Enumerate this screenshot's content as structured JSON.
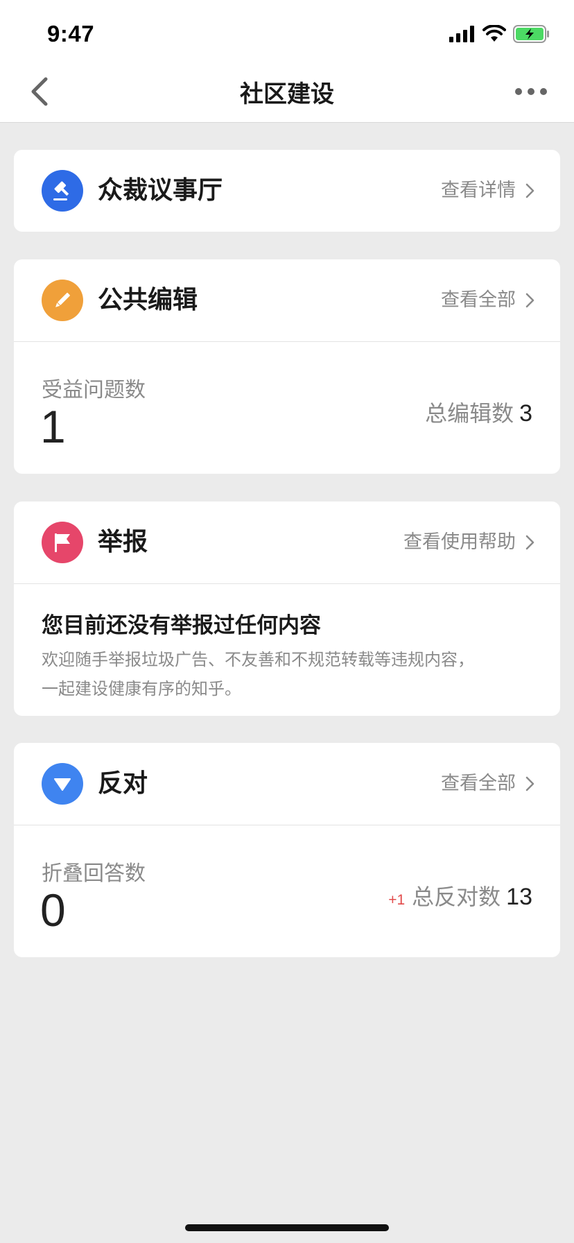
{
  "status_bar": {
    "time": "9:47"
  },
  "nav": {
    "title": "社区建设"
  },
  "colors": {
    "jury": "#2e6be6",
    "edit": "#f0a03a",
    "report": "#e6466a",
    "oppose": "#3f84f0",
    "delta": "#e24a4a"
  },
  "jury": {
    "title": "众裁议事厅",
    "link": "查看详情",
    "icon": "gavel-icon"
  },
  "edit": {
    "title": "公共编辑",
    "link": "查看全部",
    "icon": "pencil-icon",
    "stat_label": "受益问题数",
    "stat_value": "1",
    "total_label": "总编辑数",
    "total_value": "3"
  },
  "report": {
    "title": "举报",
    "link": "查看使用帮助",
    "icon": "flag-icon",
    "empty_title": "您目前还没有举报过任何内容",
    "empty_line1": "欢迎随手举报垃圾广告、不友善和不规范转载等违规内容，",
    "empty_line2": "一起建设健康有序的知乎。"
  },
  "oppose": {
    "title": "反对",
    "link": "查看全部",
    "icon": "triangle-down-icon",
    "stat_label": "折叠回答数",
    "stat_value": "0",
    "delta": "+1",
    "total_label": "总反对数",
    "total_value": "13"
  }
}
